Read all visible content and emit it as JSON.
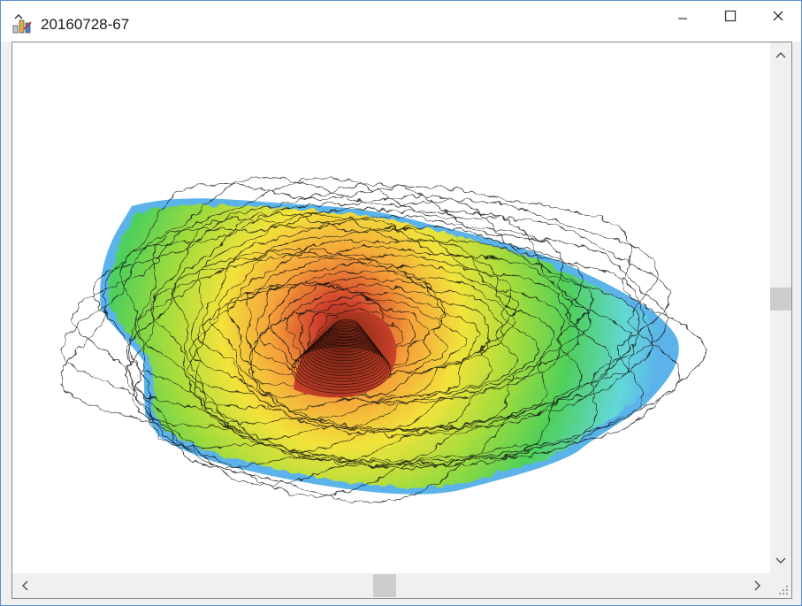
{
  "window": {
    "title": "20160728-67",
    "app_icon": "render-app-icon",
    "controls": [
      "minimize-icon",
      "maximize-icon",
      "close-icon"
    ]
  },
  "canvas": {
    "content": "3d-contour-surface-plot",
    "palette": [
      "#5bb3ea",
      "#63d7d9",
      "#4fcf5a",
      "#a4dc3c",
      "#f2e33b",
      "#f5a13a",
      "#d2432c",
      "#8c2a1c"
    ]
  },
  "scrollbars": {
    "vertical": {
      "up_icon": "chevron-up-icon",
      "down_icon": "chevron-down-icon",
      "position": 0.48
    },
    "horizontal": {
      "left_icon": "chevron-left-icon",
      "right_icon": "chevron-right-icon",
      "position": 0.49
    }
  }
}
